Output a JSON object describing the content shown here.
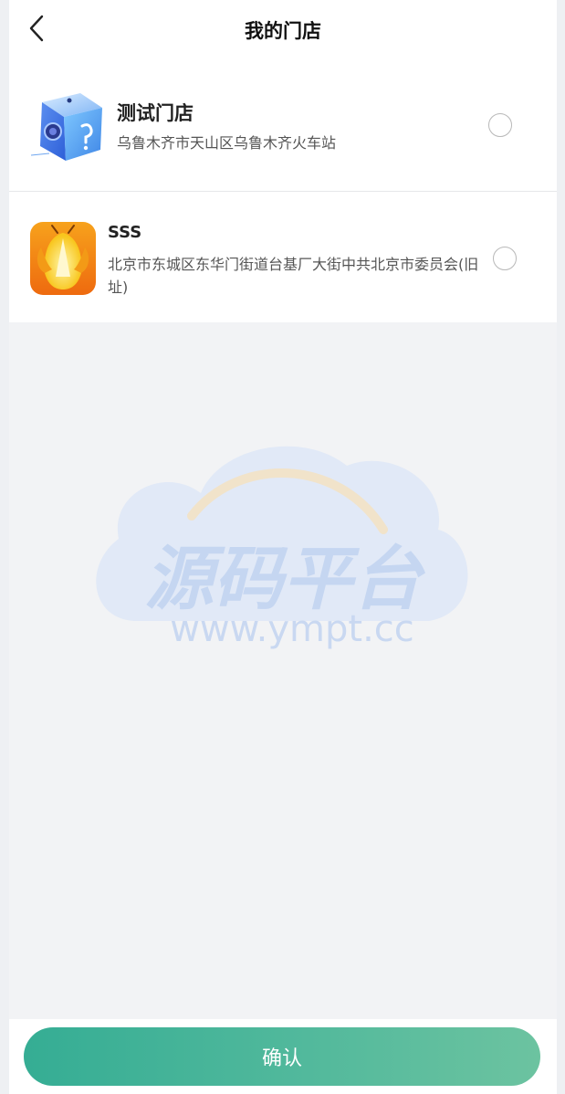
{
  "header": {
    "title": "我的门店",
    "back_icon": "chevron-left-icon"
  },
  "stores": [
    {
      "name": "测试门店",
      "address": "乌鲁木齐市天山区乌鲁木齐火车站",
      "selected": false,
      "logo_icon": "cube-logo-icon"
    },
    {
      "name": "SSS",
      "address": "北京市东城区东华门街道台基厂大街中共北京市委员会(旧址)",
      "selected": false,
      "logo_icon": "firefly-logo-icon"
    }
  ],
  "watermark": {
    "title": "源码平台",
    "url": "www.ympt.cc"
  },
  "footer": {
    "confirm_label": "确认"
  },
  "colors": {
    "primary_start": "#35ad94",
    "primary_end": "#6cc3a0",
    "background": "#f2f3f5"
  }
}
